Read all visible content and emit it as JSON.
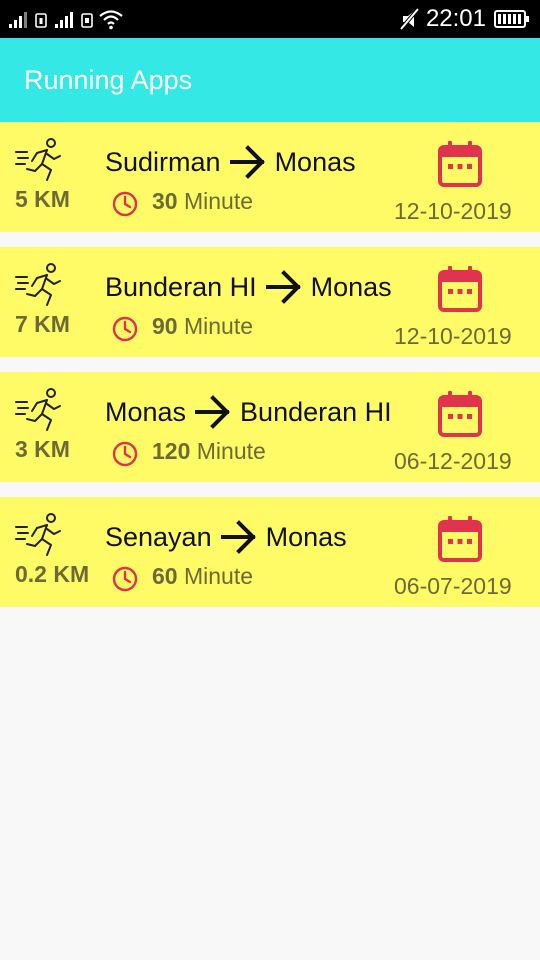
{
  "status_bar": {
    "time": "22:01",
    "icons": [
      "signal-icon",
      "sim-1-icon",
      "signal-icon",
      "sim-2-icon",
      "wifi-icon",
      "mute-icon",
      "battery-icon"
    ]
  },
  "app_bar": {
    "title": "Running Apps",
    "color": "#34e8e5"
  },
  "colors": {
    "card_background": "#fffb66",
    "accent_red": "#e0334e",
    "text_olive": "#6d6a36"
  },
  "runs": [
    {
      "distance": "5 KM",
      "from": "Sudirman",
      "to": "Monas",
      "duration_value": "30",
      "duration_unit": "Minute",
      "date": "12-10-2019"
    },
    {
      "distance": "7 KM",
      "from": "Bunderan HI",
      "to": "Monas",
      "duration_value": "90",
      "duration_unit": "Minute",
      "date": "12-10-2019"
    },
    {
      "distance": "3 KM",
      "from": "Monas",
      "to": "Bunderan HI",
      "duration_value": "120",
      "duration_unit": "Minute",
      "date": "06-12-2019"
    },
    {
      "distance": "0.2 KM",
      "from": "Senayan",
      "to": "Monas",
      "duration_value": "60",
      "duration_unit": "Minute",
      "date": "06-07-2019"
    }
  ]
}
